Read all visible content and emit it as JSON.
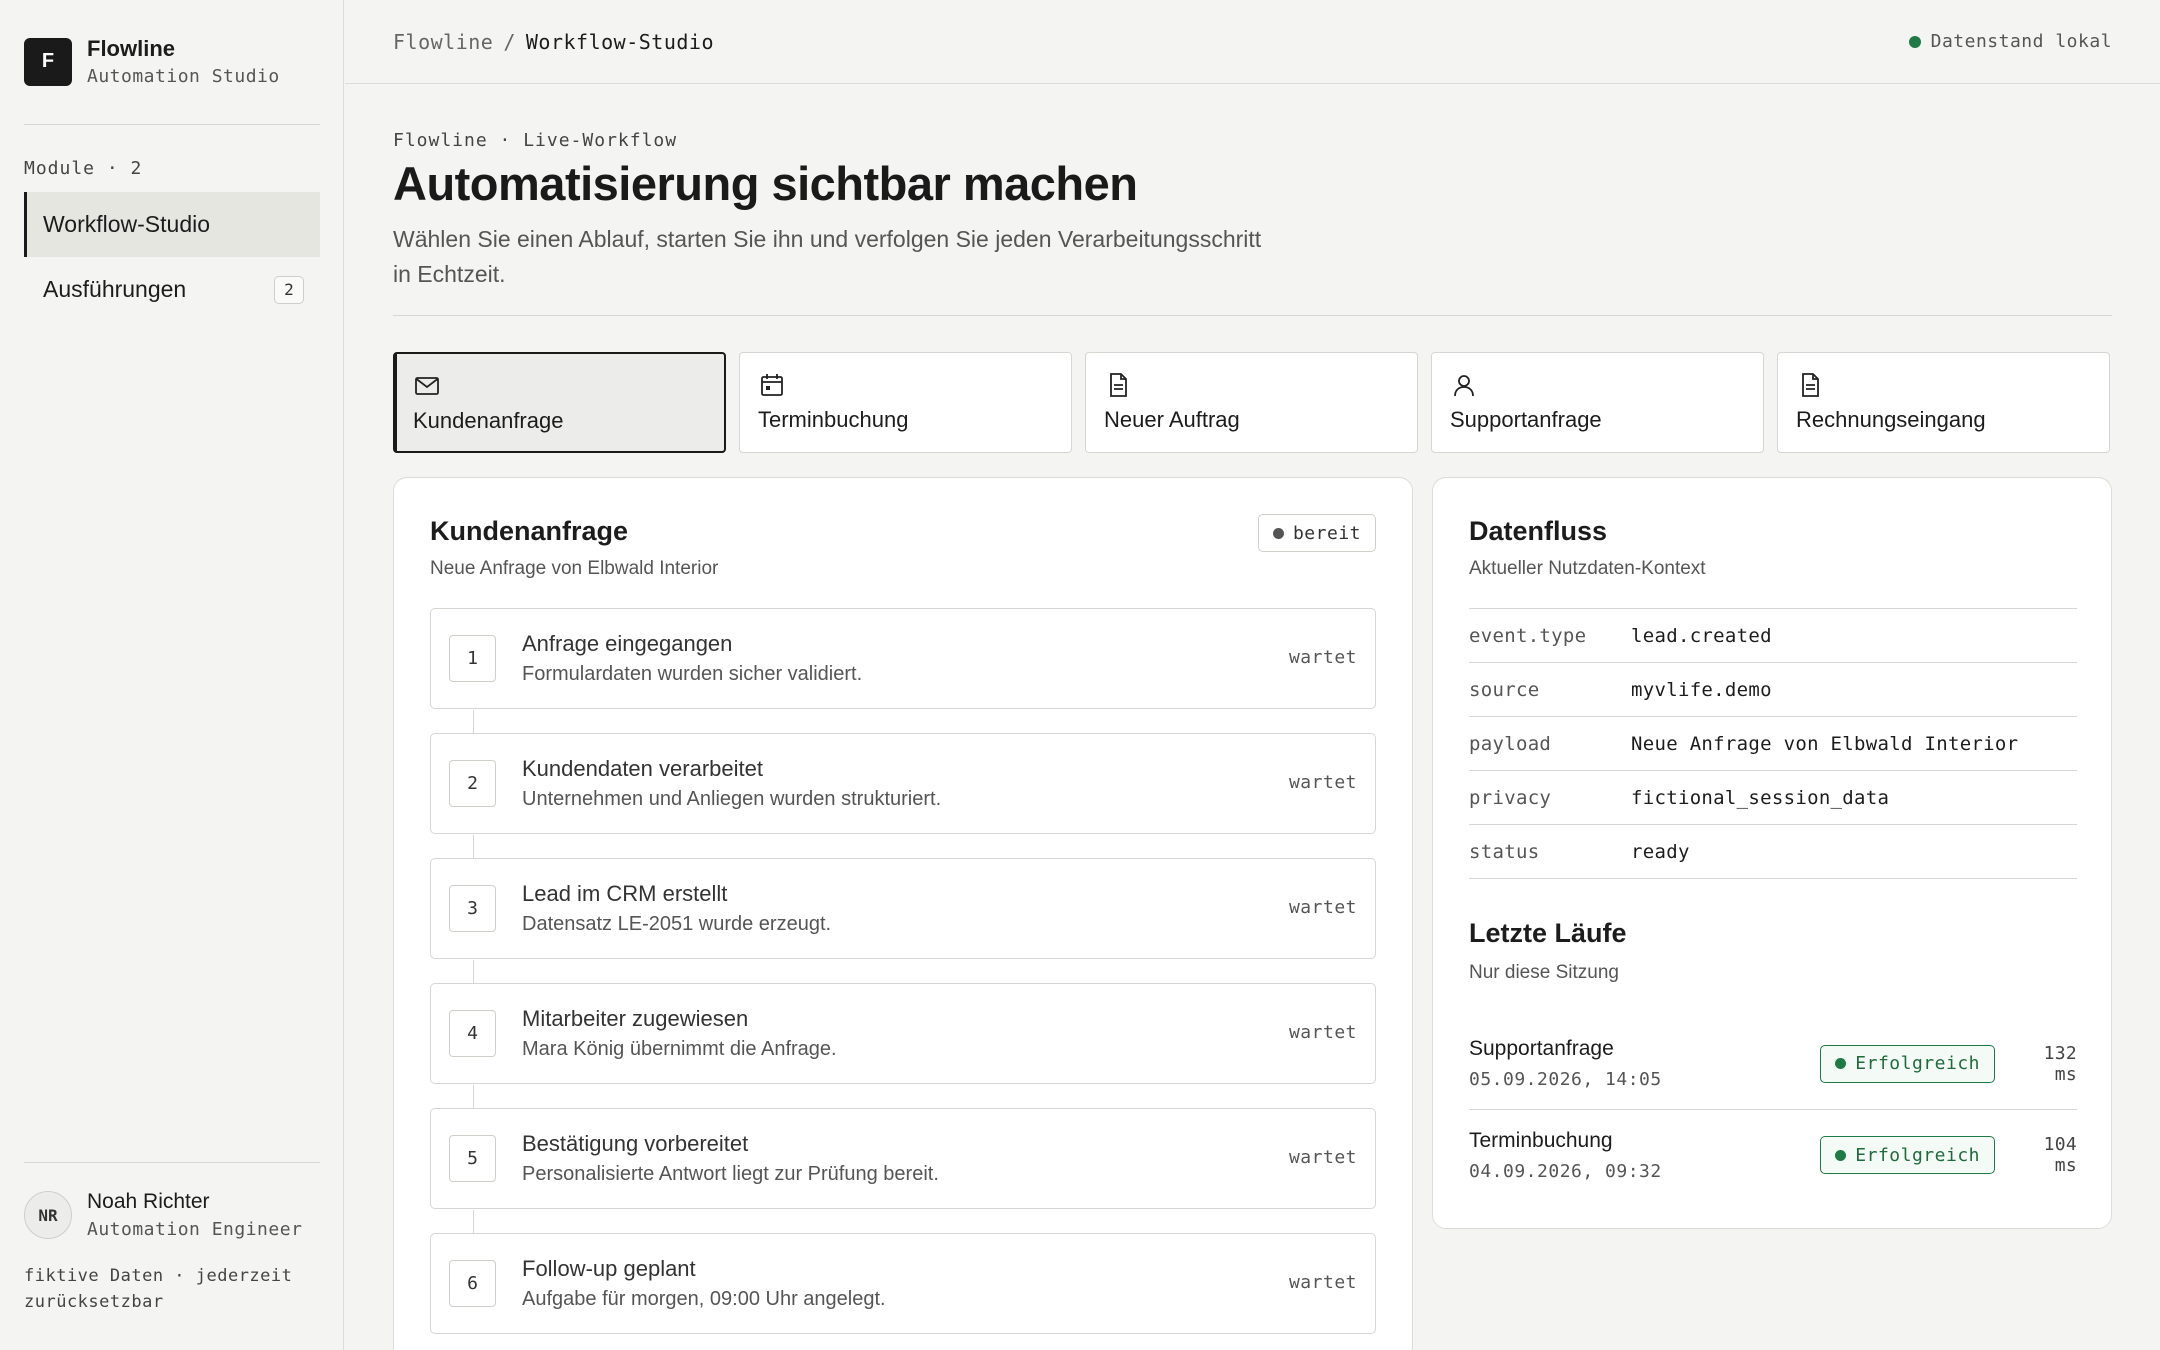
{
  "brand": {
    "logo_letter": "F",
    "name": "Flowline",
    "subtitle": "Automation Studio"
  },
  "sidebar": {
    "modules_label": "Module · 2",
    "items": [
      {
        "label": "Workflow-Studio",
        "active": true
      },
      {
        "label": "Ausführungen",
        "badge": "2"
      }
    ],
    "user": {
      "initials": "NR",
      "name": "Noah Richter",
      "role": "Automation Engineer"
    },
    "footnote": "fiktive Daten · jederzeit zurücksetzbar"
  },
  "topbar": {
    "breadcrumb_root": "Flowline",
    "breadcrumb_sep": "/",
    "breadcrumb_current": "Workflow-Studio",
    "data_state": "Datenstand lokal"
  },
  "header": {
    "eyebrow": "Flowline · Live-Workflow",
    "title": "Automatisierung sichtbar machen",
    "description": "Wählen Sie einen Ablauf, starten Sie ihn und verfolgen Sie jeden Verarbeitungsschritt in Echtzeit."
  },
  "workflows": [
    {
      "label": "Kundenanfrage",
      "icon": "mail-icon",
      "active": true
    },
    {
      "label": "Terminbuchung",
      "icon": "calendar-icon"
    },
    {
      "label": "Neuer Auftrag",
      "icon": "document-icon"
    },
    {
      "label": "Supportanfrage",
      "icon": "user-icon"
    },
    {
      "label": "Rechnungseingang",
      "icon": "document-icon"
    }
  ],
  "workflow_panel": {
    "title": "Kundenanfrage",
    "subtitle": "Neue Anfrage von Elbwald Interior",
    "status": "bereit",
    "steps": [
      {
        "num": "1",
        "title": "Anfrage eingegangen",
        "desc": "Formulardaten wurden sicher validiert.",
        "state": "wartet"
      },
      {
        "num": "2",
        "title": "Kundendaten verarbeitet",
        "desc": "Unternehmen und Anliegen wurden strukturiert.",
        "state": "wartet"
      },
      {
        "num": "3",
        "title": "Lead im CRM erstellt",
        "desc": "Datensatz LE-2051 wurde erzeugt.",
        "state": "wartet"
      },
      {
        "num": "4",
        "title": "Mitarbeiter zugewiesen",
        "desc": "Mara König übernimmt die Anfrage.",
        "state": "wartet"
      },
      {
        "num": "5",
        "title": "Bestätigung vorbereitet",
        "desc": "Personalisierte Antwort liegt zur Prüfung bereit.",
        "state": "wartet"
      },
      {
        "num": "6",
        "title": "Follow-up geplant",
        "desc": "Aufgabe für morgen, 09:00 Uhr angelegt.",
        "state": "wartet"
      }
    ]
  },
  "data_panel": {
    "title": "Datenfluss",
    "subtitle": "Aktueller Nutzdaten-Kontext",
    "rows": [
      {
        "key": "event.type",
        "value": "lead.created"
      },
      {
        "key": "source",
        "value": "myvlife.demo"
      },
      {
        "key": "payload",
        "value": "Neue Anfrage von Elbwald Interior"
      },
      {
        "key": "privacy",
        "value": "fictional_session_data"
      },
      {
        "key": "status",
        "value": "ready"
      }
    ],
    "runs_title": "Letzte Läufe",
    "runs_subtitle": "Nur diese Sitzung",
    "runs": [
      {
        "name": "Supportanfrage",
        "date": "05.09.2026, 14:05",
        "status": "Erfolgreich",
        "duration": "132 ms"
      },
      {
        "name": "Terminbuchung",
        "date": "04.09.2026, 09:32",
        "status": "Erfolgreich",
        "duration": "104 ms"
      }
    ]
  },
  "colors": {
    "accent": "#1a1a1a",
    "success": "#1f7a45",
    "background": "#f4f4f2"
  }
}
